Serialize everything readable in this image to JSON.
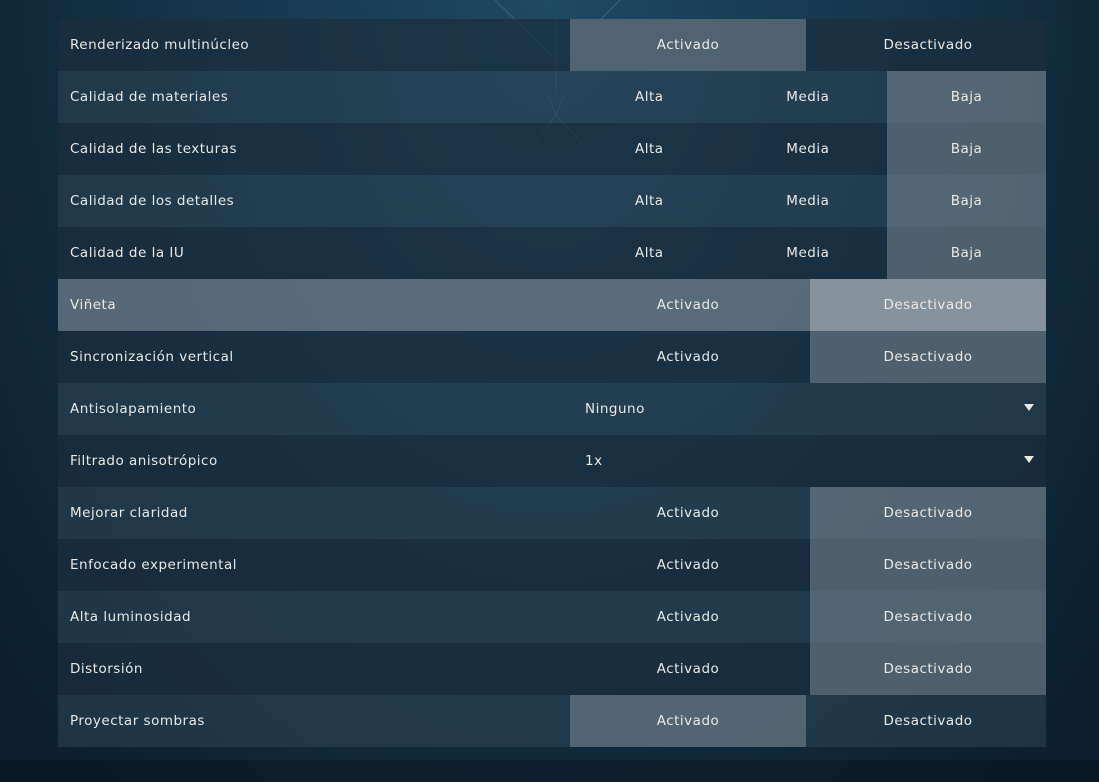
{
  "settings": [
    {
      "label": "Renderizado multinúcleo",
      "type": "toggle",
      "options": [
        "Activado",
        "Desactivado"
      ],
      "selected": 0
    },
    {
      "label": "Calidad de materiales",
      "type": "choice3",
      "options": [
        "Alta",
        "Media",
        "Baja"
      ],
      "selected": 2
    },
    {
      "label": "Calidad de las texturas",
      "type": "choice3",
      "options": [
        "Alta",
        "Media",
        "Baja"
      ],
      "selected": 2
    },
    {
      "label": "Calidad de los detalles",
      "type": "choice3",
      "options": [
        "Alta",
        "Media",
        "Baja"
      ],
      "selected": 2
    },
    {
      "label": "Calidad de la IU",
      "type": "choice3",
      "options": [
        "Alta",
        "Media",
        "Baja"
      ],
      "selected": 2
    },
    {
      "label": "Viñeta",
      "type": "toggle",
      "options": [
        "Activado",
        "Desactivado"
      ],
      "selected": 1
    },
    {
      "label": "Sincronización vertical",
      "type": "toggle",
      "options": [
        "Activado",
        "Desactivado"
      ],
      "selected": 1
    },
    {
      "label": "Antisolapamiento",
      "type": "dropdown",
      "value": "Ninguno"
    },
    {
      "label": "Filtrado anisotrópico",
      "type": "dropdown",
      "value": "1x"
    },
    {
      "label": "Mejorar claridad",
      "type": "toggle",
      "options": [
        "Activado",
        "Desactivado"
      ],
      "selected": 1
    },
    {
      "label": "Enfocado experimental",
      "type": "toggle",
      "options": [
        "Activado",
        "Desactivado"
      ],
      "selected": 1
    },
    {
      "label": "Alta luminosidad",
      "type": "toggle",
      "options": [
        "Activado",
        "Desactivado"
      ],
      "selected": 1
    },
    {
      "label": "Distorsión",
      "type": "toggle",
      "options": [
        "Activado",
        "Desactivado"
      ],
      "selected": 1
    },
    {
      "label": "Proyectar sombras",
      "type": "toggle",
      "options": [
        "Activado",
        "Desactivado"
      ],
      "selected": 0
    }
  ],
  "colors": {
    "text": "#ece8e1",
    "selected": "#7e8a94",
    "row_dark": "#1b2e3e",
    "row_light": "#2c4254"
  }
}
